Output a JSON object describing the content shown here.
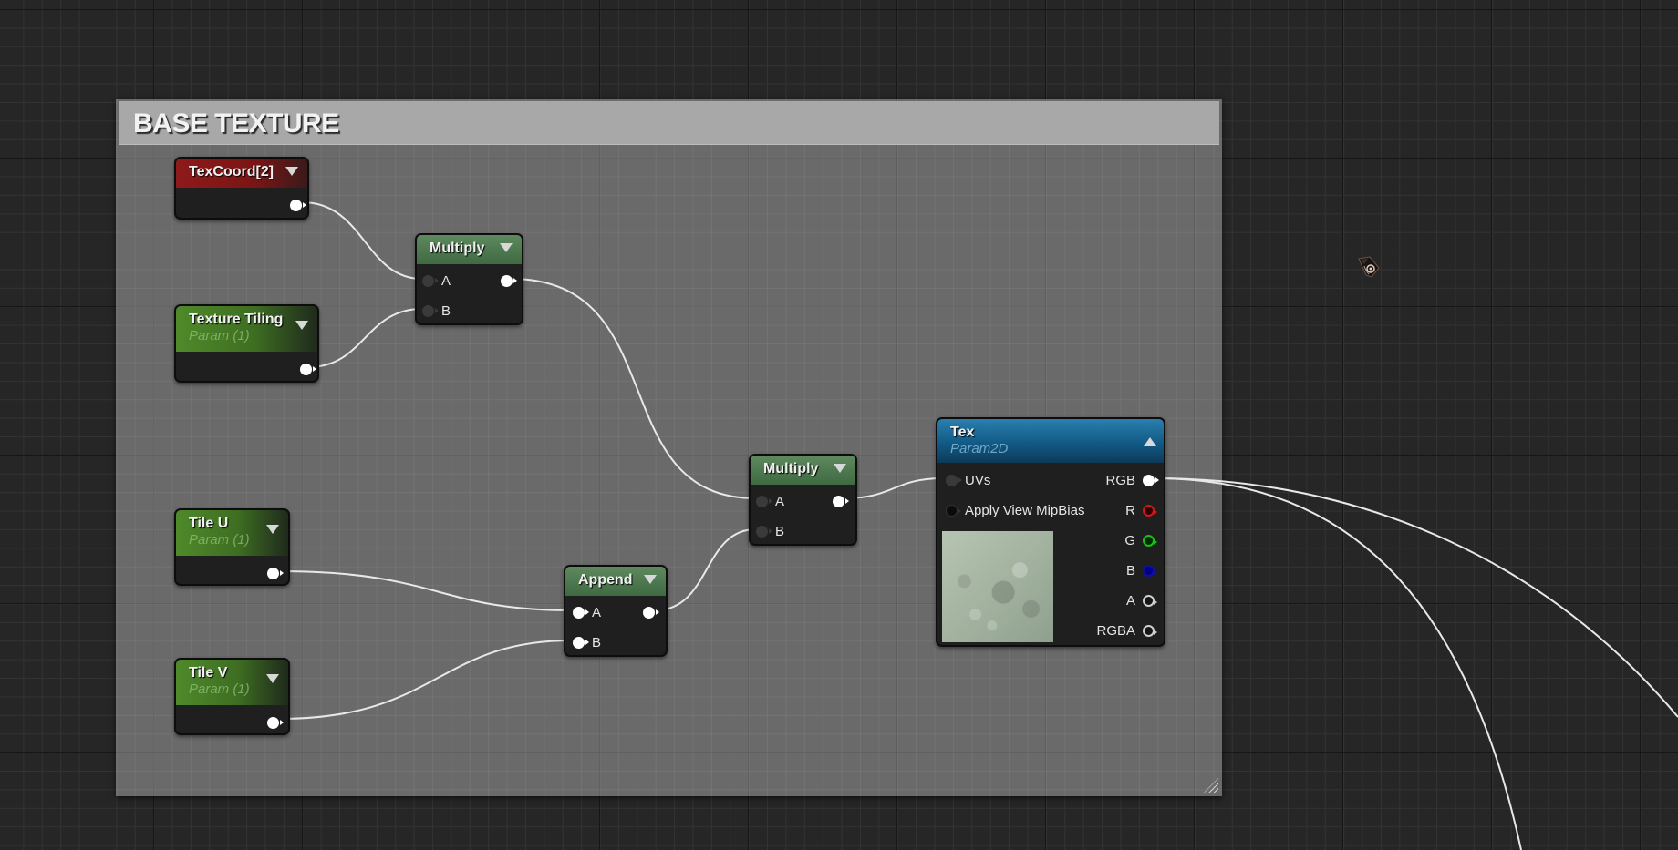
{
  "comment": {
    "title": "BASE TEXTURE"
  },
  "nodes": {
    "texcoord": {
      "title": "TexCoord[2]",
      "header_color": "#8e1a1a"
    },
    "texture_tiling": {
      "title": "Texture Tiling",
      "subtitle": "Param (1)",
      "header_color": "#4f8a2a"
    },
    "multiply1": {
      "title": "Multiply",
      "inputs": [
        "A",
        "B"
      ]
    },
    "tile_u": {
      "title": "Tile U",
      "subtitle": "Param (1)"
    },
    "tile_v": {
      "title": "Tile V",
      "subtitle": "Param (1)"
    },
    "append": {
      "title": "Append",
      "inputs": [
        "A",
        "B"
      ]
    },
    "multiply2": {
      "title": "Multiply",
      "inputs": [
        "A",
        "B"
      ]
    },
    "tex": {
      "title": "Tex",
      "subtitle": "Param2D",
      "header_color": "#125a86",
      "inputs": [
        "UVs",
        "Apply View MipBias"
      ],
      "outputs": [
        "RGB",
        "R",
        "G",
        "B",
        "A",
        "RGBA"
      ]
    }
  },
  "pin_colors": {
    "R": "#d11818",
    "G": "#17c117",
    "B": "#1010a0",
    "wire": "#e8e8e8"
  }
}
